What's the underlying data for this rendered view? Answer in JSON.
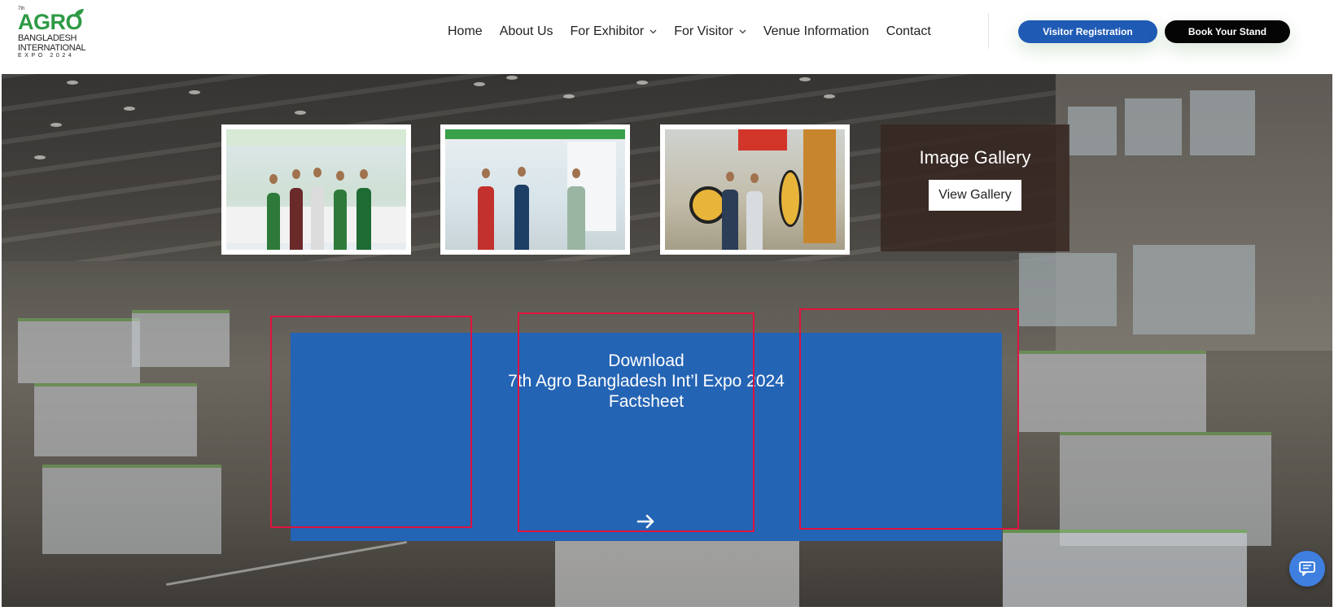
{
  "logo": {
    "superscript": "7th",
    "word": "AGRO",
    "line2": "BANGLADESH",
    "line3": "INTERNATIONAL",
    "line4": "EXPO 2024"
  },
  "nav": {
    "items": [
      {
        "label": "Home",
        "has_dropdown": false
      },
      {
        "label": "About Us",
        "has_dropdown": false
      },
      {
        "label": "For Exhibitor",
        "has_dropdown": true
      },
      {
        "label": "For Visitor",
        "has_dropdown": true
      },
      {
        "label": "Venue Information",
        "has_dropdown": false
      },
      {
        "label": "Contact",
        "has_dropdown": false
      }
    ],
    "dropdown_icon": "chevron-down-icon"
  },
  "header_buttons": {
    "visitor_registration": "Visitor Registration",
    "book_stand": "Book Your Stand"
  },
  "gallery": {
    "title": "Image Gallery",
    "button_label": "View Gallery"
  },
  "factsheet": {
    "line1": "Download",
    "line2": "7th Agro Bangladesh Int’l Expo 2024",
    "line3": "Factsheet",
    "arrow_icon": "arrow-right-icon"
  },
  "chat": {
    "icon": "chat-icon"
  },
  "colors": {
    "primary_blue": "#1f5bb5",
    "factsheet_blue": "#2464b4",
    "brand_green": "#2e9a45",
    "overlay_red": "#e0123f",
    "dark_button": "#050505"
  }
}
